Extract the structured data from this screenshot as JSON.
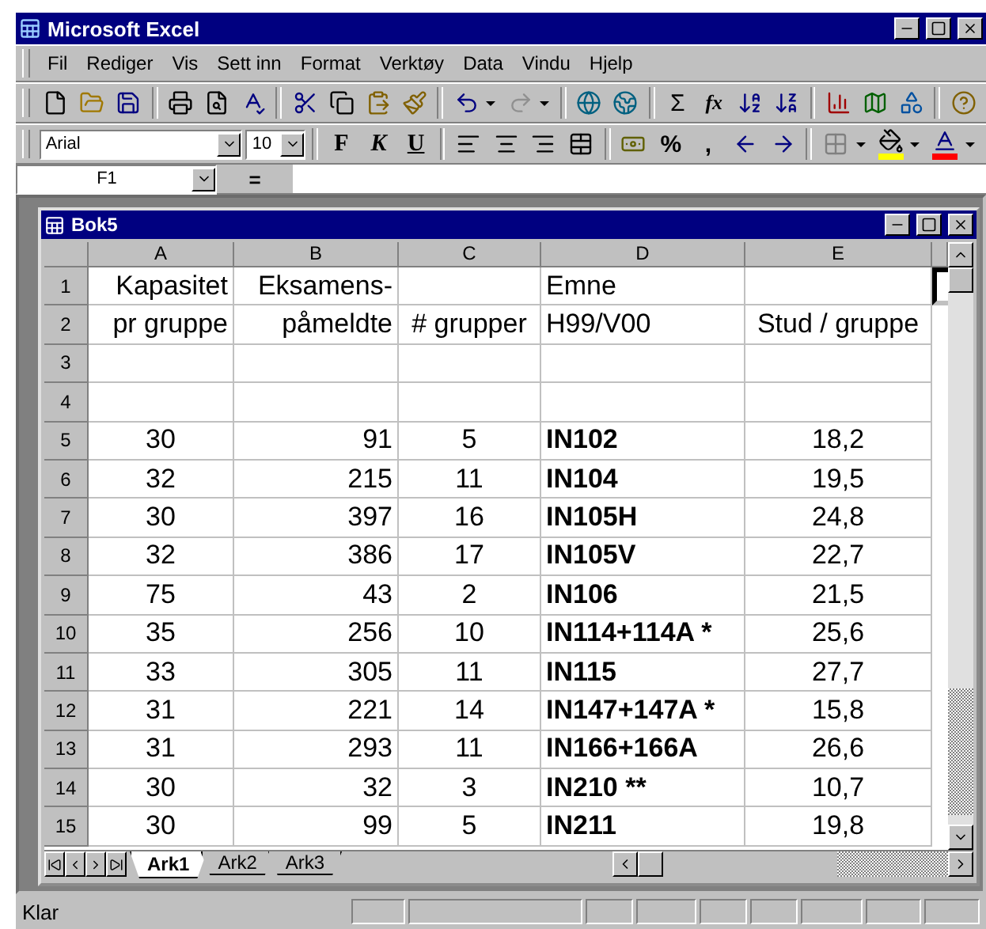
{
  "window": {
    "title": "Microsoft Excel"
  },
  "menu": [
    "Fil",
    "Rediger",
    "Vis",
    "Sett inn",
    "Format",
    "Verktøy",
    "Data",
    "Vindu",
    "Hjelp"
  ],
  "standard_toolbar": {
    "sum": "Σ",
    "function": "fx"
  },
  "formatting_toolbar": {
    "font": "Arial",
    "size": "10",
    "bold": "F",
    "italic": "K",
    "underline": "U",
    "percent": "%",
    "comma": ","
  },
  "formula_bar": {
    "name_box": "F1",
    "equals": "="
  },
  "workbook": {
    "title": "Bok5",
    "columns": [
      "A",
      "B",
      "C",
      "D",
      "E"
    ],
    "rows": [
      {
        "number": "1",
        "kind": "header",
        "cells": [
          "Kapasitet",
          "Eksamens-",
          "",
          "Emne",
          ""
        ],
        "selected_next": true
      },
      {
        "number": "2",
        "kind": "header",
        "cells": [
          "pr gruppe",
          "påmeldte",
          "# grupper",
          "H99/V00",
          "Stud / gruppe"
        ],
        "selected_next": false
      },
      {
        "number": "3",
        "kind": "data",
        "cells": [
          "",
          "",
          "",
          "",
          ""
        ],
        "selected_next": false
      },
      {
        "number": "4",
        "kind": "data",
        "cells": [
          "",
          "",
          "",
          "",
          ""
        ],
        "selected_next": false
      },
      {
        "number": "5",
        "kind": "data",
        "cells": [
          "30",
          "91",
          "5",
          "IN102",
          "18,2"
        ],
        "selected_next": false
      },
      {
        "number": "6",
        "kind": "data",
        "cells": [
          "32",
          "215",
          "11",
          "IN104",
          "19,5"
        ],
        "selected_next": false
      },
      {
        "number": "7",
        "kind": "data",
        "cells": [
          "30",
          "397",
          "16",
          "IN105H",
          "24,8"
        ],
        "selected_next": false
      },
      {
        "number": "8",
        "kind": "data",
        "cells": [
          "32",
          "386",
          "17",
          "IN105V",
          "22,7"
        ],
        "selected_next": false
      },
      {
        "number": "9",
        "kind": "data",
        "cells": [
          "75",
          "43",
          "2",
          "IN106",
          "21,5"
        ],
        "selected_next": false
      },
      {
        "number": "10",
        "kind": "data",
        "cells": [
          "35",
          "256",
          "10",
          "IN114+114A *",
          "25,6"
        ],
        "selected_next": false
      },
      {
        "number": "11",
        "kind": "data",
        "cells": [
          "33",
          "305",
          "11",
          "IN115",
          "27,7"
        ],
        "selected_next": false
      },
      {
        "number": "12",
        "kind": "data",
        "cells": [
          "31",
          "221",
          "14",
          "IN147+147A *",
          "15,8"
        ],
        "selected_next": false
      },
      {
        "number": "13",
        "kind": "data",
        "cells": [
          "31",
          "293",
          "11",
          "IN166+166A",
          "26,6"
        ],
        "selected_next": false
      },
      {
        "number": "14",
        "kind": "data",
        "cells": [
          "30",
          "32",
          "3",
          "IN210 **",
          "10,7"
        ],
        "selected_next": false
      },
      {
        "number": "15",
        "kind": "data",
        "cells": [
          "30",
          "99",
          "5",
          "IN211",
          "19,8"
        ],
        "selected_next": false
      }
    ],
    "sheets": [
      {
        "label": "Ark1",
        "selected": true
      },
      {
        "label": "Ark2",
        "selected": false
      },
      {
        "label": "Ark3",
        "selected": false
      }
    ]
  },
  "status_bar": {
    "text": "Klar"
  }
}
